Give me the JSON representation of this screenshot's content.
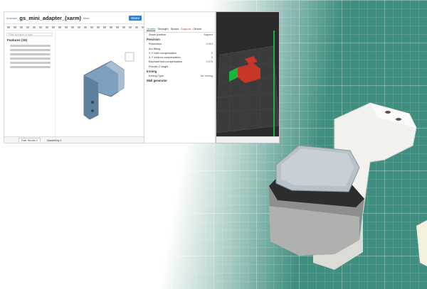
{
  "onshape": {
    "logo": "onshape",
    "document_title": "gs_mini_adapter_(xarm)",
    "branch": "Main",
    "share_label": "Share",
    "filter_placeholder": "Filter by name or type",
    "feature_tree_title": "Features (19)",
    "tabs": [
      "Part Studio 1",
      "Assembly 1"
    ]
  },
  "slicer_settings": {
    "tabs": [
      "Quality",
      "Strength",
      "Speed",
      "Support",
      "Others"
    ],
    "rows": [
      {
        "label": "Seam position",
        "value": "Aligned"
      },
      {
        "label": "Resolution",
        "value": "0.012"
      },
      {
        "label": "Arc fitting",
        "value": ""
      },
      {
        "label": "X-Y hole compensation",
        "value": "0"
      },
      {
        "label": "X-Y contour compensation",
        "value": "0"
      },
      {
        "label": "Elephant foot compensation",
        "value": "0.075"
      },
      {
        "label": "Precise Z height",
        "value": ""
      }
    ],
    "sections": [
      "Precision",
      "Ironing",
      "Wall generator"
    ],
    "ironing_type_label": "Ironing Type",
    "ironing_type_value": "No ironing"
  },
  "colors": {
    "part_blue": "#7f9fbe",
    "slicer_green": "#19b53d",
    "print_red": "#c8362a",
    "mat_green": "#3f8f80"
  }
}
